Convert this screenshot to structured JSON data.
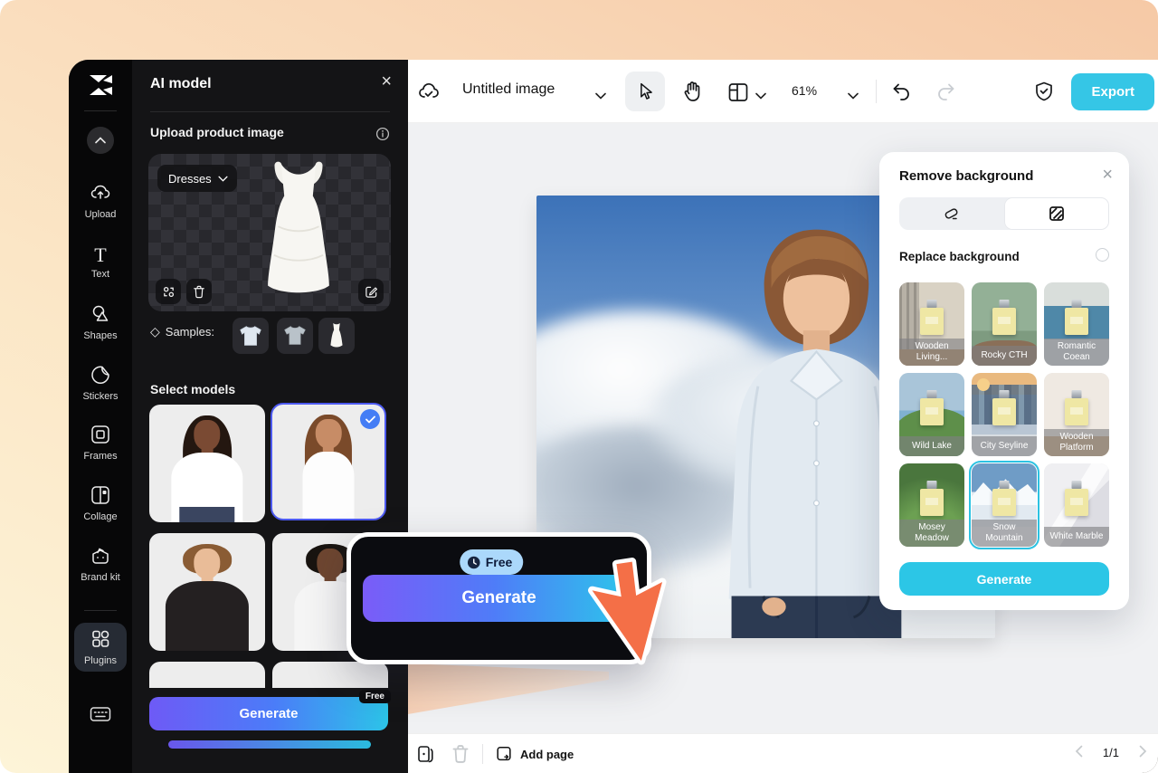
{
  "window": {
    "doc_title": "Untitled image",
    "zoom_level": "61%",
    "export_label": "Export"
  },
  "sidebar": {
    "items": [
      {
        "label": "Upload"
      },
      {
        "label": "Text"
      },
      {
        "label": "Shapes"
      },
      {
        "label": "Stickers"
      },
      {
        "label": "Frames"
      },
      {
        "label": "Collage"
      },
      {
        "label": "Brand kit"
      },
      {
        "label": "Plugins"
      }
    ]
  },
  "panel": {
    "title": "AI model",
    "upload_heading": "Upload product image",
    "category": "Dresses",
    "samples_label": "Samples:",
    "select_models_heading": "Select models",
    "generate_label": "Generate",
    "free_badge": "Free"
  },
  "remove_bg": {
    "title": "Remove background",
    "replace_heading": "Replace background",
    "generate_label": "Generate",
    "thumbs": [
      {
        "label": "Wooden Living..."
      },
      {
        "label": "Rocky CTH"
      },
      {
        "label": "Romantic Coean"
      },
      {
        "label": "Wild Lake"
      },
      {
        "label": "City Seyline"
      },
      {
        "label": "Wooden Platform"
      },
      {
        "label": "Mosey Meadow"
      },
      {
        "label": "Snow Mountain",
        "selected": true
      },
      {
        "label": "White Marble"
      }
    ]
  },
  "callout": {
    "free_label": "Free",
    "generate_label": "Generate"
  },
  "footer": {
    "add_page": "Add page",
    "page_indicator": "1/1"
  },
  "colors": {
    "accent_cyan": "#2cc6e6",
    "gradient_start": "#6e5af6",
    "gradient_end": "#2cc4e8",
    "selection_blue": "#4d5af0",
    "cursor_orange": "#f46f47"
  }
}
